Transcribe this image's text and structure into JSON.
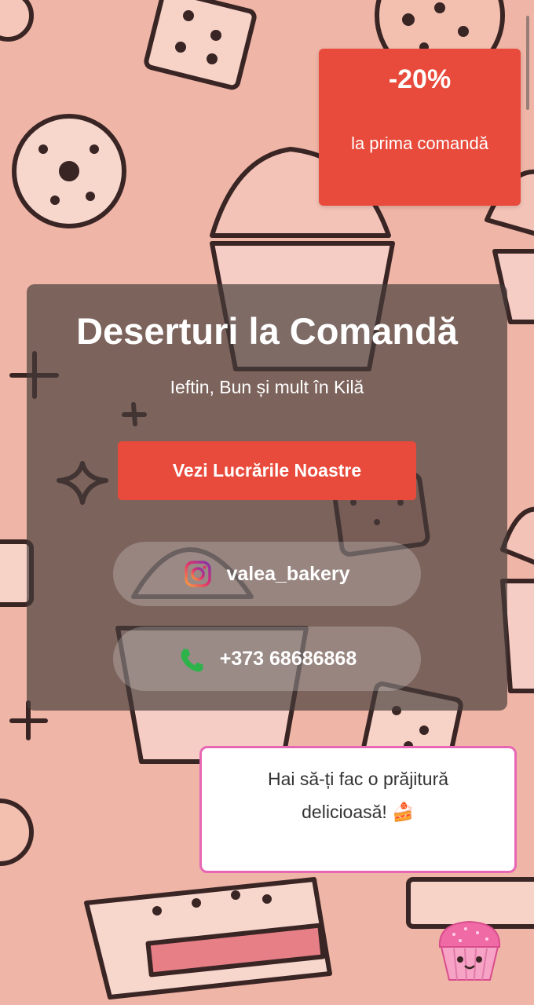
{
  "promo": {
    "discount": "-20%",
    "text": "la prima comandă"
  },
  "hero": {
    "title": "Deserturi la Comandă",
    "subtitle": "Ieftin, Bun și mult în Kilă",
    "cta_label": "Vezi Lucrările Noastre"
  },
  "contacts": {
    "instagram": {
      "icon": "instagram-icon",
      "handle": "valea_bakery"
    },
    "phone": {
      "icon": "phone-icon",
      "number": "+373 68686868"
    }
  },
  "chat_bubble": {
    "text": "Hai să-ți fac o prăjitură delicioasă! 🍰"
  },
  "mascot": {
    "icon": "cupcake-mascot-icon"
  },
  "colors": {
    "accent": "#e84a3b",
    "background": "#efb5a6",
    "bubble_border": "#e867b4"
  }
}
